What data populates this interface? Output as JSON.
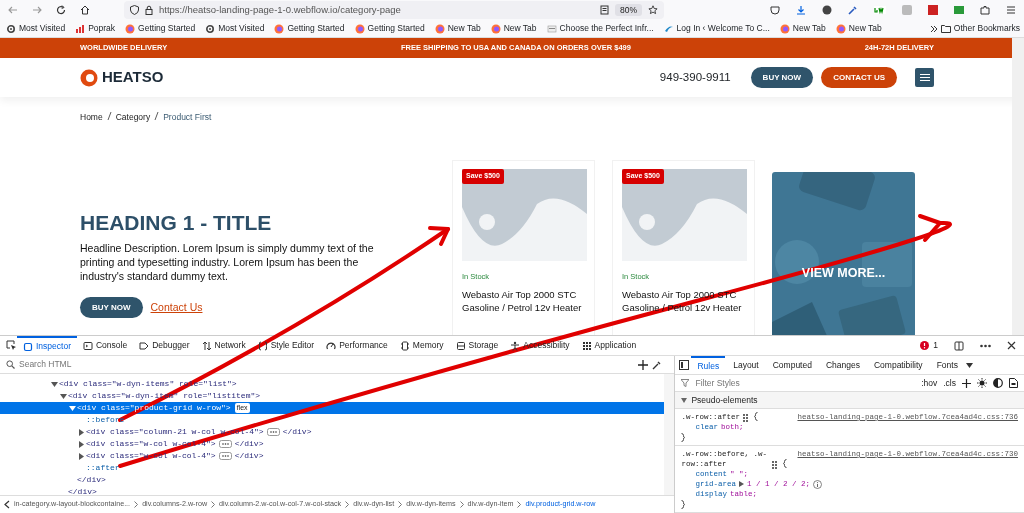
{
  "browser": {
    "url": "https://heatso-landing-page-1-0.webflow.io/category-page",
    "zoom": "80%",
    "bookmarks": [
      {
        "label": "Most Visited",
        "kind": "gear"
      },
      {
        "label": "Poprak",
        "kind": "chart"
      },
      {
        "label": "Getting Started",
        "kind": "firefox"
      },
      {
        "label": "Most Visited",
        "kind": "gear"
      },
      {
        "label": "Getting Started",
        "kind": "firefox"
      },
      {
        "label": "Getting Started",
        "kind": "firefox"
      },
      {
        "label": "New Tab",
        "kind": "firefox"
      },
      {
        "label": "New Tab",
        "kind": "firefox"
      },
      {
        "label": "Choose the Perfect Infr...",
        "kind": "page"
      },
      {
        "label": "Log In ‹ Welcome To C...",
        "kind": "swoosh"
      },
      {
        "label": "New Tab",
        "kind": "firefox"
      },
      {
        "label": "New Tab",
        "kind": "firefox"
      }
    ],
    "other_bookmarks": "Other Bookmarks"
  },
  "site": {
    "promo": [
      "WORLDWIDE DELIVERY",
      "FREE SHIPPING TO USA AND CANADA ON ORDERS OVER $499",
      "24H-72H DELIVERY"
    ],
    "logo": "HEATSO",
    "phone": "949-390-9911",
    "buy_now": "BUY NOW",
    "contact_us": "CONTACT US",
    "breadcrumb": [
      {
        "label": "Home",
        "current": false
      },
      {
        "label": "Category",
        "current": false
      },
      {
        "label": "Product First",
        "current": true
      }
    ],
    "hero": {
      "title": "HEADING 1 - TITLE",
      "description": "Headline Description. Lorem Ipsum is simply dummy text of the printing and typesetting industry. Lorem Ipsum has been the industry's standard dummy text.",
      "buy_now": "BUY NOW",
      "contact": "Contact Us"
    },
    "products": [
      {
        "badge": "Save $500",
        "stock": "In Stock",
        "title": "Webasto Air Top 2000 STC Gasoline / Petrol 12v Heater"
      },
      {
        "badge": "Save $500",
        "stock": "In Stock",
        "title": "Webasto Air Top 2000 STC Gasoline / Petrol 12v Heater"
      }
    ],
    "view_more": "VIEW MORE..."
  },
  "devtools": {
    "tabs": [
      {
        "label": "Inspector",
        "kind": "box",
        "selected": true
      },
      {
        "label": "Console",
        "kind": "terminal",
        "selected": false
      },
      {
        "label": "Debugger",
        "kind": "tag",
        "selected": false
      },
      {
        "label": "Network",
        "kind": "updown",
        "selected": false
      },
      {
        "label": "Style Editor",
        "kind": "braces",
        "selected": false
      },
      {
        "label": "Performance",
        "kind": "gauge",
        "selected": false
      },
      {
        "label": "Memory",
        "kind": "chip",
        "selected": false
      },
      {
        "label": "Storage",
        "kind": "cylinder",
        "selected": false
      },
      {
        "label": "Accessibility",
        "kind": "figure",
        "selected": false
      },
      {
        "label": "Application",
        "kind": "grid",
        "selected": false
      }
    ],
    "error_count": "1",
    "search_placeholder": "Search HTML",
    "tree": [
      {
        "kind": "element",
        "markup": "<div class=\"w-dyn-items\" role=\"list\">",
        "expanded": true,
        "selected": false,
        "children": [
          {
            "kind": "element",
            "markup": "<div class=\"w-dyn-item\" role=\"listitem\">",
            "expanded": true,
            "selected": false,
            "close": "</div>",
            "children": [
              {
                "kind": "element",
                "markup": "<div class=\"product-grid w-row\">",
                "expanded": true,
                "selected": true,
                "badge": "flex",
                "close": "</div>",
                "children": [
                  {
                    "kind": "pseudo",
                    "markup": "::before"
                  },
                  {
                    "kind": "element",
                    "markup": "<div class=\"column-21 w-col w-col-4\">",
                    "expanded": false,
                    "selected": false,
                    "close": "</div>"
                  },
                  {
                    "kind": "element",
                    "markup": "<div class=\"w-col w-col-4\">",
                    "expanded": false,
                    "selected": false,
                    "close": "</div>"
                  },
                  {
                    "kind": "element",
                    "markup": "<div class=\"w-col w-col-4\">",
                    "expanded": false,
                    "selected": false,
                    "close": "</div>"
                  },
                  {
                    "kind": "pseudo",
                    "markup": "::after"
                  }
                ]
              }
            ]
          }
        ]
      }
    ],
    "breadcrumb": [
      {
        "label": "in-category.w-layout-blockcontaine...",
        "selected": false
      },
      {
        "label": "div.columns-2.w-row",
        "selected": false
      },
      {
        "label": "div.column-2.w-col.w-col-7.w-col-stack",
        "selected": false
      },
      {
        "label": "div.w-dyn-list",
        "selected": false
      },
      {
        "label": "div.w-dyn-items",
        "selected": false
      },
      {
        "label": "div.w-dyn-item",
        "selected": false
      },
      {
        "label": "div.product-grid.w-row",
        "selected": true
      }
    ],
    "side_tabs": [
      {
        "label": "Rules",
        "selected": true
      },
      {
        "label": "Layout",
        "selected": false
      },
      {
        "label": "Computed",
        "selected": false
      },
      {
        "label": "Changes",
        "selected": false
      },
      {
        "label": "Compatibility",
        "selected": false
      },
      {
        "label": "Fonts",
        "selected": false
      }
    ],
    "filter_placeholder": "Filter Styles",
    "hov": ":hov",
    "cls": ".cls",
    "section": "Pseudo-elements",
    "rules": [
      {
        "selector": ".w-row::after",
        "source": "heatso-landing-page-1-0.webflow.7cea4ad4c.css:736",
        "declarations": [
          {
            "property": "clear",
            "value": "both;"
          }
        ]
      },
      {
        "selector": ".w-row::before, .w-row::after",
        "source": "heatso-landing-page-1-0.webflow.7cea4ad4c.css:730",
        "declarations": [
          {
            "property": "content",
            "value": "\" \";"
          },
          {
            "property": "grid-area",
            "value": "1 / 1 / 2 / 2;",
            "expandable": true,
            "info": true
          },
          {
            "property": "display",
            "value": "table;"
          }
        ]
      }
    ]
  }
}
